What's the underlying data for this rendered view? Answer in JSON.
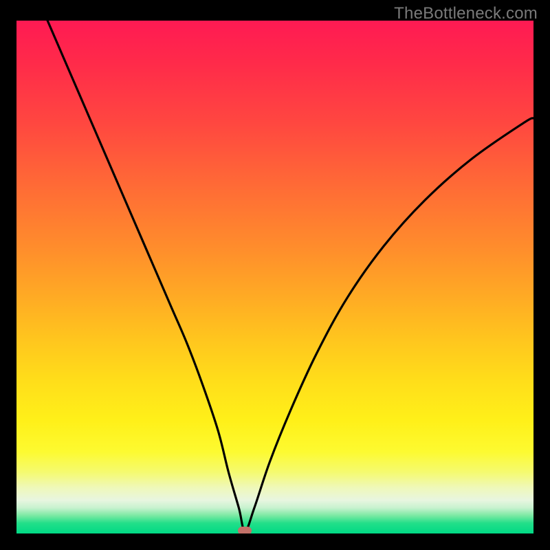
{
  "watermark": "TheBottleneck.com",
  "chart_data": {
    "type": "line",
    "title": "",
    "xlabel": "",
    "ylabel": "",
    "xlim": [
      0,
      100
    ],
    "ylim": [
      0,
      100
    ],
    "background_gradient": {
      "top": "#ff1a53",
      "middle": "#ffdd1a",
      "bottom": "#00d985",
      "meaning": "red-high to green-low (bottleneck severity)"
    },
    "series": [
      {
        "name": "bottleneck-curve",
        "color": "#000000",
        "x": [
          6,
          9,
          12,
          15,
          18,
          21,
          24,
          27,
          30,
          33,
          36,
          39,
          41,
          43,
          44.2,
          46,
          49,
          53,
          58,
          64,
          71,
          79,
          88,
          98,
          100
        ],
        "y": [
          100,
          93,
          86,
          79,
          72,
          65,
          58,
          51,
          44,
          37,
          29,
          20,
          12,
          5,
          0.5,
          5,
          14,
          24,
          35,
          46,
          56,
          65,
          73,
          80,
          81
        ]
      }
    ],
    "minimum_marker": {
      "x": 44.2,
      "y": 0.5,
      "color": "#c37169"
    }
  }
}
